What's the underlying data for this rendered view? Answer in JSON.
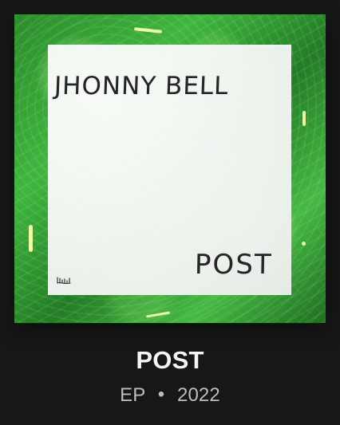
{
  "album": {
    "cover": {
      "artist_text": "JHONNY BELL",
      "release_text": "POST",
      "colors": {
        "border": "#39a93a",
        "inner": "#f2f4f2",
        "text": "#262626",
        "accent": "#e8ff95"
      }
    },
    "title": "POST",
    "meta": {
      "type": "EP",
      "separator": "•",
      "year": "2022"
    }
  }
}
